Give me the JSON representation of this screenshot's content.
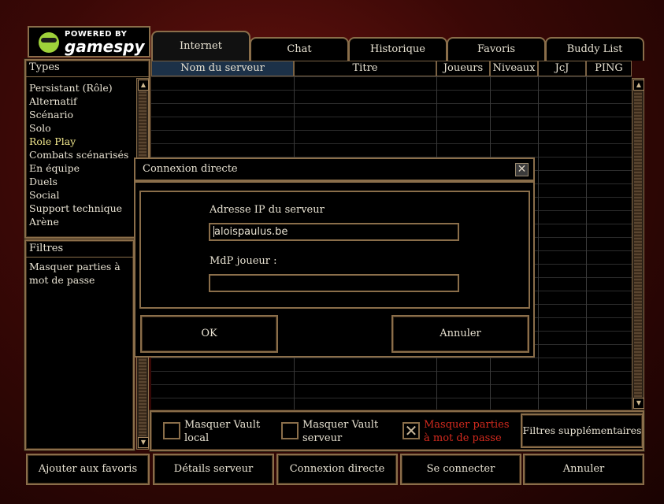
{
  "logo": {
    "powered_by": "POWERED BY",
    "brand": "gamespy"
  },
  "tabs": [
    {
      "label": "Internet",
      "active": true
    },
    {
      "label": "Chat",
      "active": false
    },
    {
      "label": "Historique",
      "active": false
    },
    {
      "label": "Favoris",
      "active": false
    },
    {
      "label": "Buddy List",
      "active": false
    }
  ],
  "columns": [
    "Nom du serveur",
    "Titre",
    "Joueurs",
    "Niveaux",
    "JcJ",
    "PING"
  ],
  "types": {
    "header": "Types",
    "items": [
      {
        "label": "Persistant (Rôle)",
        "selected": false
      },
      {
        "label": "Alternatif",
        "selected": false
      },
      {
        "label": "Scénario",
        "selected": false
      },
      {
        "label": "Solo",
        "selected": false
      },
      {
        "label": "Role Play",
        "selected": true
      },
      {
        "label": "Combats scénarisés",
        "selected": false
      },
      {
        "label": "En équipe",
        "selected": false
      },
      {
        "label": "Duels",
        "selected": false
      },
      {
        "label": "Social",
        "selected": false
      },
      {
        "label": "Support technique",
        "selected": false
      },
      {
        "label": "Arène",
        "selected": false
      }
    ]
  },
  "filters": {
    "header": "Filtres",
    "items": [
      {
        "label_line1": "Masquer parties à",
        "label_line2": "mot de passe"
      }
    ]
  },
  "options": [
    {
      "line1": "Masquer Vault",
      "line2": "local",
      "checked": false
    },
    {
      "line1": "Masquer Vault",
      "line2": "serveur",
      "checked": false
    },
    {
      "line1": "Masquer parties",
      "line2": "à mot de passe",
      "checked": true
    }
  ],
  "extra_filters_button": "Filtres supplémentaires",
  "bottom_buttons": [
    "Ajouter aux favoris",
    "Détails serveur",
    "Connexion directe",
    "Se connecter",
    "Annuler"
  ],
  "dialog": {
    "title": "Connexion directe",
    "ip_label": "Adresse IP du serveur",
    "ip_value": "aloispaulus.be",
    "password_label": "MdP joueur :",
    "password_value": "",
    "ok": "OK",
    "cancel": "Annuler"
  },
  "colors": {
    "bronze": "#8a6e4a",
    "selected_text": "#f0e68c",
    "checked_option_text": "#d32a1e",
    "active_column": "#1c3148"
  },
  "icons": {
    "scroll_up": "arrow-up-icon",
    "scroll_down": "arrow-down-icon",
    "close": "close-icon",
    "checkbox_checked": "x-mark-icon"
  }
}
